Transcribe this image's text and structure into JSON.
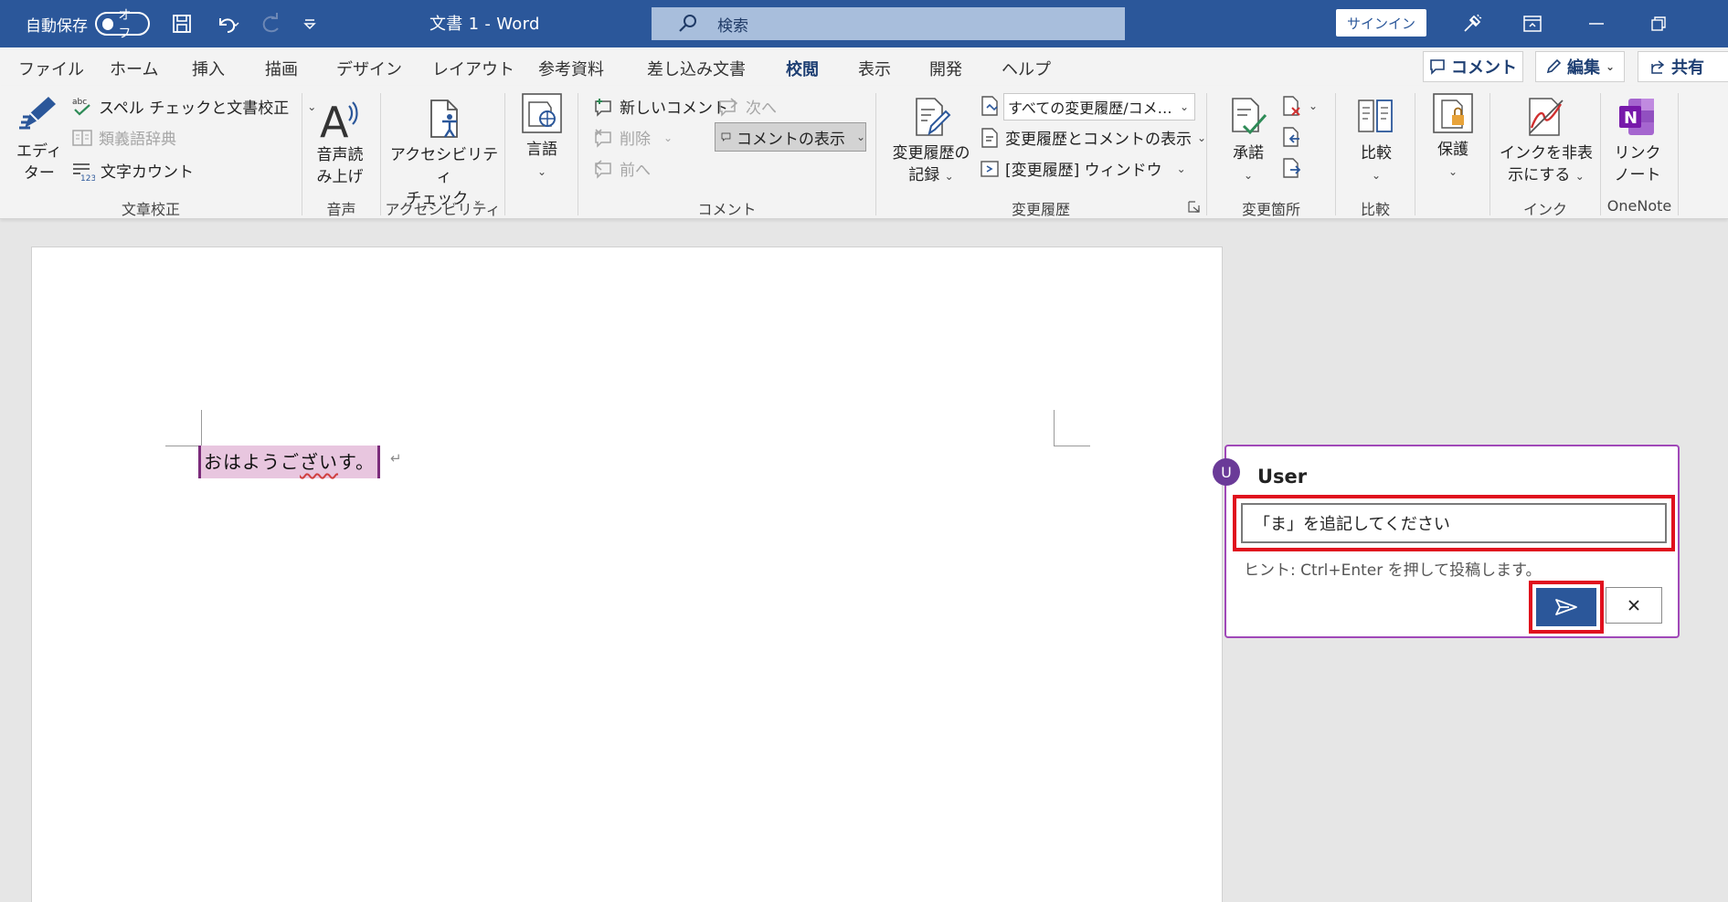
{
  "titlebar": {
    "autosave_label": "自動保存",
    "autosave_state": "オフ",
    "doc_title": "文書 1  -  Word",
    "search_placeholder": "検索",
    "signin": "サインイン",
    "bg_color": "#2b579a"
  },
  "tabs": [
    {
      "label": "ファイル"
    },
    {
      "label": "ホーム"
    },
    {
      "label": "挿入"
    },
    {
      "label": "描画"
    },
    {
      "label": "デザイン"
    },
    {
      "label": "レイアウト"
    },
    {
      "label": "参考資料"
    },
    {
      "label": "差し込み文書"
    },
    {
      "label": "校閲",
      "active": true
    },
    {
      "label": "表示"
    },
    {
      "label": "開発"
    },
    {
      "label": "ヘルプ"
    }
  ],
  "tab_actions": {
    "comment": "コメント",
    "edit": "編集",
    "share": "共有"
  },
  "ribbon": {
    "proofing": {
      "editor_line1": "エディ",
      "editor_line2": "ター",
      "spell": "スペル チェックと文書校正",
      "thesaurus": "類義語辞典",
      "wordcount": "文字カウント",
      "group": "文章校正"
    },
    "speech": {
      "readaloud_line1": "音声読",
      "readaloud_line2": "み上げ",
      "group": "音声"
    },
    "accessibility": {
      "check_line1": "アクセシビリティ",
      "check_line2": "チェック",
      "group": "アクセシビリティ"
    },
    "language": {
      "label": "言語"
    },
    "comments": {
      "new": "新しいコメント",
      "next": "次へ",
      "delete": "削除",
      "prev": "前へ",
      "show": "コメントの表示",
      "group": "コメント"
    },
    "tracking": {
      "track_line1": "変更履歴の",
      "track_line2": "記録",
      "markup_select": "すべての変更履歴/コメ…",
      "show_markup": "変更履歴とコメントの表示",
      "pane": "[変更履歴] ウィンドウ",
      "group": "変更履歴"
    },
    "changes": {
      "accept": "承諾",
      "group": "変更箇所"
    },
    "compare": {
      "label": "比較",
      "group": "比較"
    },
    "protect": {
      "label": "保護"
    },
    "ink": {
      "hide_line1": "インクを非表",
      "hide_line2": "示にする",
      "group": "インク"
    },
    "onenote": {
      "link_line1": "リンク",
      "link_line2": "ノート",
      "group": "OneNote"
    }
  },
  "document": {
    "text_part1": "おはようご",
    "text_part2": "ざい",
    "text_part3": "す。",
    "para_mark": "↵"
  },
  "comment": {
    "avatar_initial": "U",
    "user": "User",
    "input_value": "「ま」を追記してください",
    "hint": "ヒント: Ctrl+Enter を押して投稿します。",
    "border_color": "#a048b8",
    "highlight_color": "#e0101e"
  }
}
